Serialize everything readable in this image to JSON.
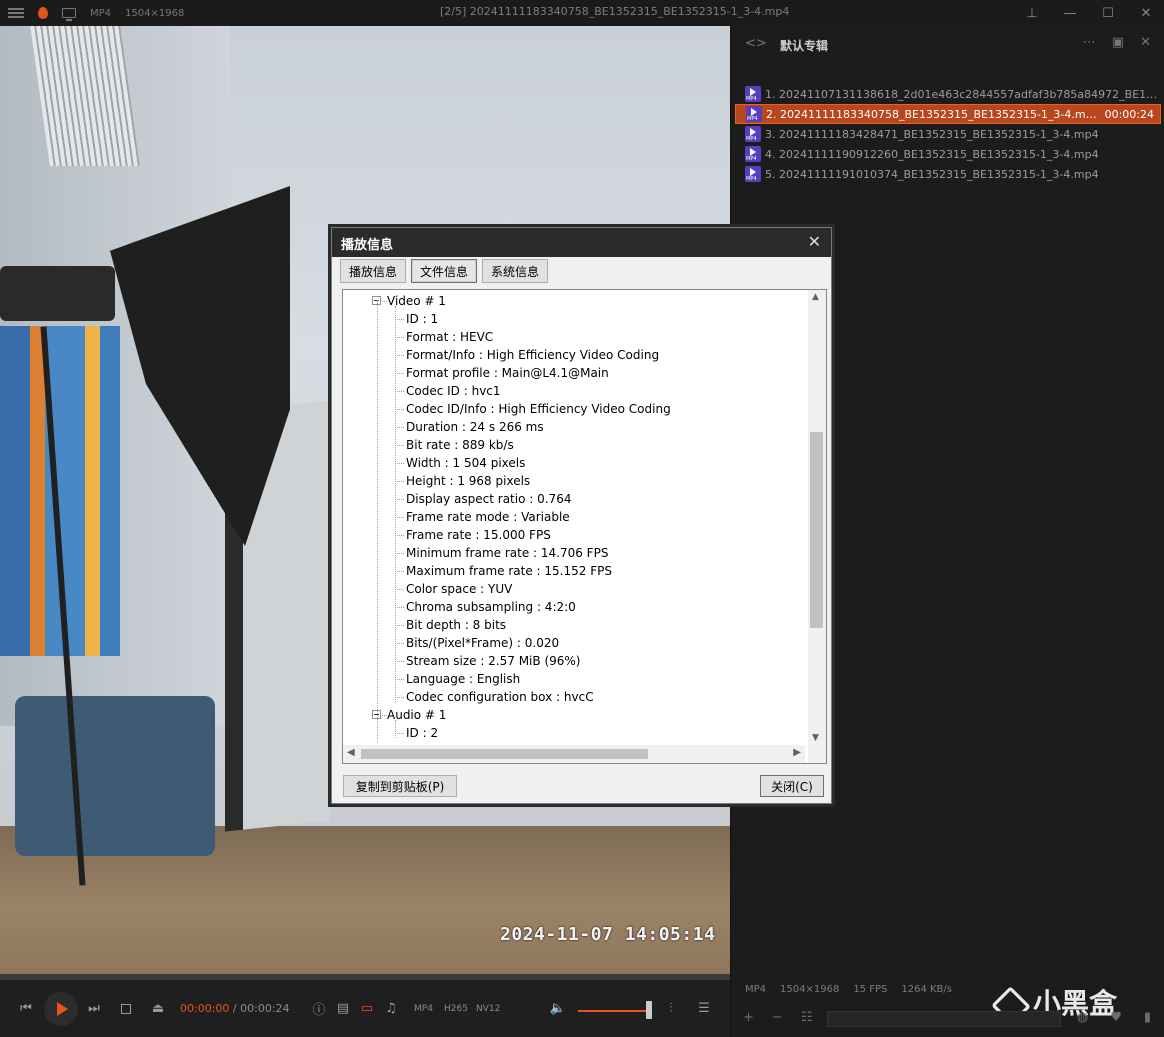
{
  "titlebar": {
    "format": "MP4",
    "resolution": "1504×1968",
    "title": "[2/5] 20241111183340758_BE1352315_BE1352315-1_3-4.mp4"
  },
  "video": {
    "timestamp": "2024-11-07  14:05:14",
    "progress": 0.0
  },
  "controls": {
    "current_time": "00:00:00",
    "separator": "/",
    "total_time": "00:00:24",
    "codec_tags": [
      "MP4",
      "H265",
      "NV12"
    ],
    "volume": 1.0
  },
  "playlist": {
    "title": "默认专辑",
    "items": [
      {
        "label": "1. 20241107131138618_2d01e463c2844557adfaf3b785a84972_BE1352315...",
        "duration": "",
        "active": false
      },
      {
        "label": "2. 20241111183340758_BE1352315_BE1352315-1_3-4.mp4",
        "duration": "00:00:24",
        "active": true
      },
      {
        "label": "3. 20241111183428471_BE1352315_BE1352315-1_3-4.mp4",
        "duration": "",
        "active": false
      },
      {
        "label": "4. 20241111190912260_BE1352315_BE1352315-1_3-4.mp4",
        "duration": "",
        "active": false
      },
      {
        "label": "5. 20241111191010374_BE1352315_BE1352315-1_3-4.mp4",
        "duration": "",
        "active": false
      }
    ],
    "info": {
      "format": "MP4",
      "resolution": "1504×1968",
      "fps": "15 FPS",
      "bitrate": "1264 KB/s"
    }
  },
  "watermark": {
    "text": "小黑盒"
  },
  "dialog": {
    "title": "播放信息",
    "tabs": [
      "播放信息",
      "文件信息",
      "系统信息"
    ],
    "active_tab": 1,
    "tree": {
      "video_group": "Video # 1",
      "video_fields": [
        "ID : 1",
        "Format : HEVC",
        "Format/Info : High Efficiency Video Coding",
        "Format profile : Main@L4.1@Main",
        "Codec ID : hvc1",
        "Codec ID/Info : High Efficiency Video Coding",
        "Duration : 24 s 266 ms",
        "Bit rate : 889 kb/s",
        "Width : 1 504 pixels",
        "Height : 1 968 pixels",
        "Display aspect ratio : 0.764",
        "Frame rate mode : Variable",
        "Frame rate : 15.000 FPS",
        "Minimum frame rate : 14.706 FPS",
        "Maximum frame rate : 15.152 FPS",
        "Color space : YUV",
        "Chroma subsampling : 4:2:0",
        "Bit depth : 8 bits",
        "Bits/(Pixel*Frame) : 0.020",
        "Stream size : 2.57 MiB (96%)",
        "Language : English",
        "Codec configuration box : hvcC"
      ],
      "audio_group": "Audio # 1",
      "audio_fields": [
        "ID : 2"
      ]
    },
    "copy_button": "复制到剪贴板(P)",
    "close_button": "关闭(C)"
  }
}
